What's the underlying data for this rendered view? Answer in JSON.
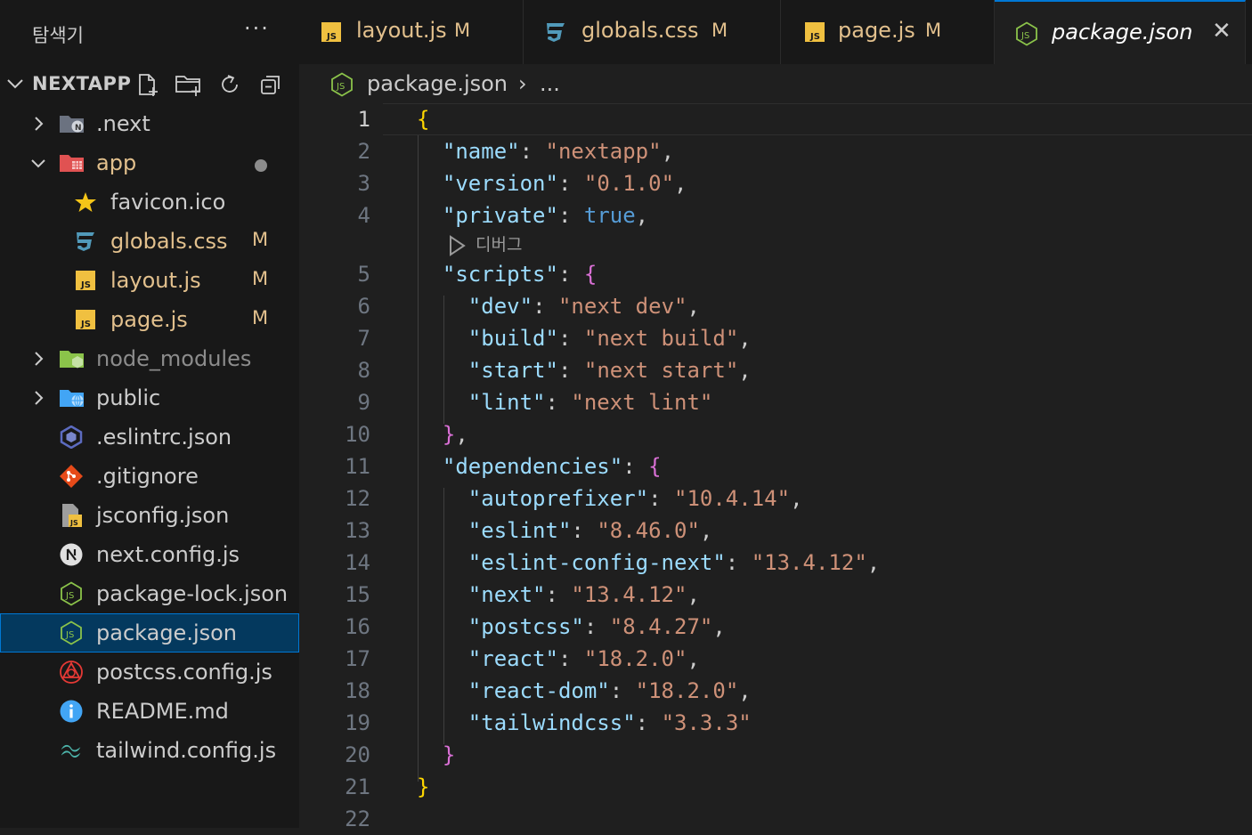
{
  "explorer": {
    "title": "탐색기",
    "more": "···",
    "project": "NEXTAPP"
  },
  "tree": [
    {
      "label": ".next",
      "type": "folder",
      "depth": 0,
      "icon": "next-folder-icon",
      "collapsed": true
    },
    {
      "label": "app",
      "type": "folder",
      "depth": 0,
      "icon": "app-folder-icon",
      "expanded": true,
      "modified_dot": true
    },
    {
      "label": "favicon.ico",
      "type": "file",
      "depth": 1,
      "icon": "star-icon"
    },
    {
      "label": "globals.css",
      "type": "file",
      "depth": 1,
      "icon": "css-icon",
      "badge": "M"
    },
    {
      "label": "layout.js",
      "type": "file",
      "depth": 1,
      "icon": "js-icon",
      "badge": "M"
    },
    {
      "label": "page.js",
      "type": "file",
      "depth": 1,
      "icon": "js-icon",
      "badge": "M"
    },
    {
      "label": "node_modules",
      "type": "folder",
      "depth": 0,
      "icon": "node-folder-icon",
      "collapsed": true,
      "dim": true
    },
    {
      "label": "public",
      "type": "folder",
      "depth": 0,
      "icon": "public-folder-icon",
      "collapsed": true
    },
    {
      "label": ".eslintrc.json",
      "type": "file",
      "depth": 0,
      "icon": "eslint-icon"
    },
    {
      "label": ".gitignore",
      "type": "file",
      "depth": 0,
      "icon": "git-icon"
    },
    {
      "label": "jsconfig.json",
      "type": "file",
      "depth": 0,
      "icon": "jsconfig-icon"
    },
    {
      "label": "next.config.js",
      "type": "file",
      "depth": 0,
      "icon": "next-icon"
    },
    {
      "label": "package-lock.json",
      "type": "file",
      "depth": 0,
      "icon": "nodejs-icon"
    },
    {
      "label": "package.json",
      "type": "file",
      "depth": 0,
      "icon": "nodejs-icon",
      "selected": true
    },
    {
      "label": "postcss.config.js",
      "type": "file",
      "depth": 0,
      "icon": "postcss-icon"
    },
    {
      "label": "README.md",
      "type": "file",
      "depth": 0,
      "icon": "info-icon"
    },
    {
      "label": "tailwind.config.js",
      "type": "file",
      "depth": 0,
      "icon": "tailwind-icon"
    }
  ],
  "tabs": [
    {
      "label": "layout.js",
      "badge": "M",
      "icon": "js-icon"
    },
    {
      "label": "globals.css",
      "badge": "M",
      "icon": "css-icon"
    },
    {
      "label": "page.js",
      "badge": "M",
      "icon": "js-icon"
    },
    {
      "label": "package.json",
      "icon": "nodejs-icon",
      "active": true,
      "close": "✕"
    }
  ],
  "breadcrumb": {
    "file": "package.json",
    "separator": "›",
    "more": "..."
  },
  "codelens": {
    "label": "디버그"
  },
  "code": [
    {
      "n": "1"
    },
    {
      "n": "2"
    },
    {
      "n": "3"
    },
    {
      "n": "4"
    },
    {
      "n": "5"
    },
    {
      "n": "6"
    },
    {
      "n": "7"
    },
    {
      "n": "8"
    },
    {
      "n": "9"
    },
    {
      "n": "10"
    },
    {
      "n": "11"
    },
    {
      "n": "12"
    },
    {
      "n": "13"
    },
    {
      "n": "14"
    },
    {
      "n": "15"
    },
    {
      "n": "16"
    },
    {
      "n": "17"
    },
    {
      "n": "18"
    },
    {
      "n": "19"
    },
    {
      "n": "20"
    },
    {
      "n": "21"
    },
    {
      "n": "22"
    }
  ],
  "json": {
    "name": "nextapp",
    "version": "0.1.0",
    "private": "true",
    "scripts": {
      "dev": "next dev",
      "build": "next build",
      "start": "next start",
      "lint": "next lint"
    },
    "dependencies": {
      "autoprefixer": "10.4.14",
      "eslint": "8.46.0",
      "eslint-config-next": "13.4.12",
      "next": "13.4.12",
      "postcss": "8.4.27",
      "react": "18.2.0",
      "react-dom": "18.2.0",
      "tailwindcss": "3.3.3"
    }
  },
  "keys": {
    "name": "name",
    "version": "version",
    "private": "private",
    "scripts": "scripts",
    "dev": "dev",
    "build": "build",
    "start": "start",
    "lint": "lint",
    "dependencies": "dependencies",
    "autoprefixer": "autoprefixer",
    "eslint": "eslint",
    "eslint_config_next": "eslint-config-next",
    "next": "next",
    "postcss": "postcss",
    "react": "react",
    "react_dom": "react-dom",
    "tailwindcss": "tailwindcss"
  },
  "colors": {
    "modified": "#e2c08d",
    "accent": "#0078d4",
    "js": "#f0c040",
    "css": "#519aba",
    "nodejs": "#8bc34a"
  }
}
